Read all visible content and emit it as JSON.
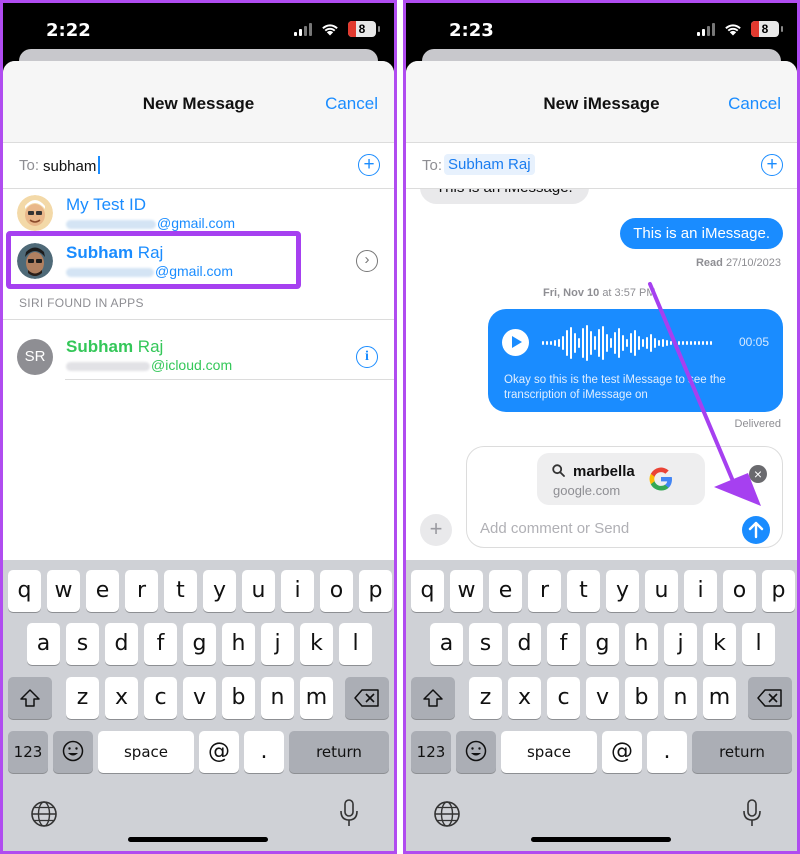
{
  "colors": {
    "accent": "#1a8cff",
    "highlight": "#a640f0",
    "imessage_blue": "#1a8cff",
    "contact_green": "#34c759"
  },
  "left": {
    "status": {
      "time": "2:22",
      "battery": "8"
    },
    "nav": {
      "title": "New Message",
      "cancel": "Cancel"
    },
    "to": {
      "label": "To:",
      "text": "subham"
    },
    "contacts": [
      {
        "first": "My",
        "last": "Test ID",
        "email_suffix": "@gmail.com"
      },
      {
        "first": "Subham",
        "last": "Raj",
        "email_suffix": "@gmail.com"
      }
    ],
    "siri_label": "SIRI FOUND IN APPS",
    "siri_contact": {
      "initials": "SR",
      "first": "Subham",
      "last": "Raj",
      "email_suffix": "@icloud.com"
    }
  },
  "right": {
    "status": {
      "time": "2:23",
      "battery": "8"
    },
    "nav": {
      "title": "New iMessage",
      "cancel": "Cancel"
    },
    "to": {
      "label": "To:",
      "recipient": "Subham Raj"
    },
    "messages": {
      "received_partial": "This is an iMessage.",
      "sent": "This is an iMessage.",
      "read_label": "Read",
      "read_date": "27/10/2023",
      "timestamp_day": "Fri, Nov 10",
      "timestamp_time": "at 3:57 PM",
      "audio_duration": "00:05",
      "transcript": "Okay so this is the test iMessage to see the transcription of iMessage on",
      "delivered": "Delivered"
    },
    "link_preview": {
      "query": "marbella",
      "domain": "google.com"
    },
    "compose": {
      "placeholder": "Add comment or Send"
    }
  },
  "keyboard": {
    "row1": [
      "q",
      "w",
      "e",
      "r",
      "t",
      "y",
      "u",
      "i",
      "o",
      "p"
    ],
    "row2": [
      "a",
      "s",
      "d",
      "f",
      "g",
      "h",
      "j",
      "k",
      "l"
    ],
    "row3": [
      "z",
      "x",
      "c",
      "v",
      "b",
      "n",
      "m"
    ],
    "numbers": "123",
    "space": "space",
    "at": "@",
    "period": ".",
    "return": "return"
  },
  "icons": [
    "signal-icon",
    "wifi-icon",
    "battery-icon",
    "add-contact-icon",
    "chevron-right-icon",
    "info-icon",
    "play-icon",
    "search-icon",
    "google-logo-icon",
    "close-icon",
    "send-arrow-icon",
    "plus-icon",
    "shift-icon",
    "delete-icon",
    "emoji-icon",
    "globe-icon",
    "microphone-icon"
  ]
}
